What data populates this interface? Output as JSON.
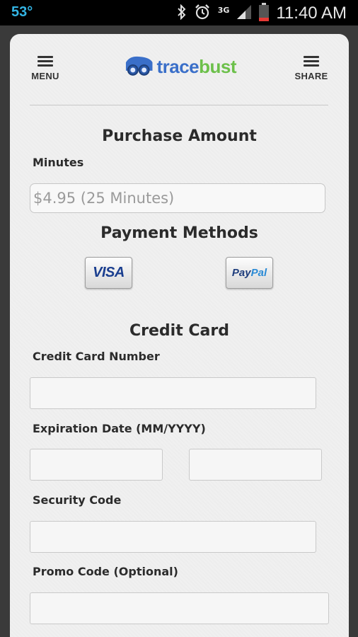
{
  "status_bar": {
    "temperature": "53°",
    "network": "3G",
    "time": "11:40 AM",
    "icons": [
      "bluetooth-icon",
      "alarm-icon",
      "signal-icon",
      "battery-icon"
    ]
  },
  "header": {
    "menu_label": "MENU",
    "share_label": "SHARE",
    "logo_part1": "trace",
    "logo_part2": "bust"
  },
  "purchase": {
    "title": "Purchase Amount",
    "minutes_label": "Minutes",
    "minutes_value": "$4.95 (25 Minutes)"
  },
  "payment": {
    "title": "Payment Methods",
    "visa_label": "VISA",
    "paypal_part1": "Pay",
    "paypal_part2": "Pal"
  },
  "credit_card": {
    "title": "Credit Card",
    "number_label": "Credit Card Number",
    "expiration_label": "Expiration Date (MM/YYYY)",
    "security_label": "Security Code",
    "promo_label": "Promo Code (Optional)"
  },
  "colors": {
    "accent_blue": "#3a6fc9",
    "accent_green": "#6cc04a",
    "status_temp": "#33b5e5"
  }
}
